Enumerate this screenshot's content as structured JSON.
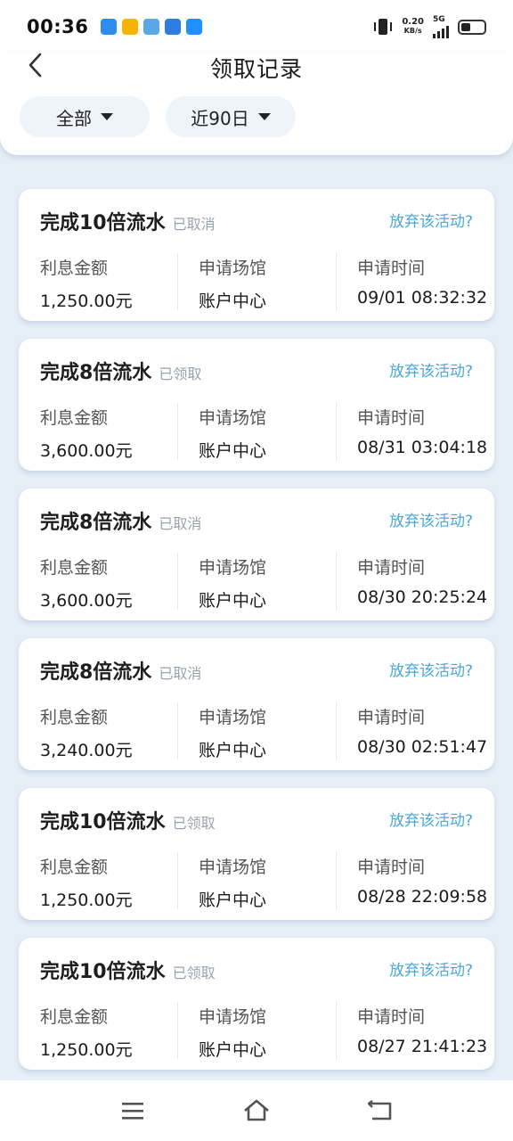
{
  "status_bar": {
    "time": "00:36",
    "net_speed_value": "0.20",
    "net_speed_unit": "KB/s",
    "network": "5G",
    "notif_colors": [
      "#2d8cf0",
      "#f4b400",
      "#5aa9e6",
      "#2f7de1",
      "#1e90ff"
    ]
  },
  "header": {
    "title": "领取记录",
    "back_icon": "chevron-left-icon",
    "filters": [
      {
        "label": "全部"
      },
      {
        "label": "近90日"
      }
    ]
  },
  "columns": {
    "amount_label": "利息金额",
    "venue_label": "申请场馆",
    "time_label": "申请时间"
  },
  "records": [
    {
      "title": "完成10倍流水",
      "status": "已取消",
      "action": "放弃该活动?",
      "amount": "1,250.00元",
      "venue": "账户中心",
      "time": "09/01 08:32:32"
    },
    {
      "title": "完成8倍流水",
      "status": "已领取",
      "action": "放弃该活动?",
      "amount": "3,600.00元",
      "venue": "账户中心",
      "time": "08/31 03:04:18"
    },
    {
      "title": "完成8倍流水",
      "status": "已取消",
      "action": "放弃该活动?",
      "amount": "3,600.00元",
      "venue": "账户中心",
      "time": "08/30 20:25:24"
    },
    {
      "title": "完成8倍流水",
      "status": "已取消",
      "action": "放弃该活动?",
      "amount": "3,240.00元",
      "venue": "账户中心",
      "time": "08/30 02:51:47"
    },
    {
      "title": "完成10倍流水",
      "status": "已领取",
      "action": "放弃该活动?",
      "amount": "1,250.00元",
      "venue": "账户中心",
      "time": "08/28 22:09:58"
    },
    {
      "title": "完成10倍流水",
      "status": "已领取",
      "action": "放弃该活动?",
      "amount": "1,250.00元",
      "venue": "账户中心",
      "time": "08/27 21:41:23"
    }
  ],
  "colors": {
    "accent_link": "#4aa8d8",
    "status_gray": "#9aa3ad",
    "page_bg": "#e6eef6"
  },
  "nav": {
    "icons": [
      "menu-icon",
      "home-icon",
      "back-icon"
    ]
  }
}
